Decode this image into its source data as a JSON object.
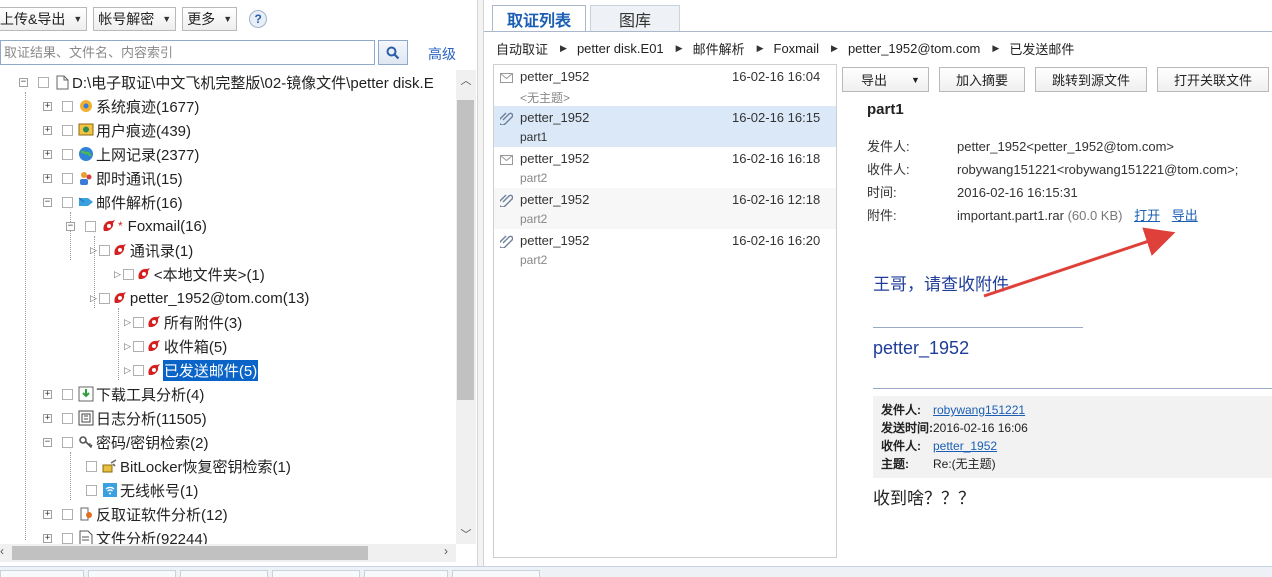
{
  "left": {
    "toolbar": {
      "upload_export": "上传&导出",
      "account_decrypt": "帐号解密",
      "more": "更多",
      "help": "?"
    },
    "search": {
      "placeholder": "取证结果、文件名、内容索引",
      "advanced": "高级"
    },
    "tree": {
      "root": "D:\\电子取证\\中文飞机完整版\\02-镜像文件\\petter disk.E",
      "system_traces": "系统痕迹(1677)",
      "user_traces": "用户痕迹(439)",
      "web_records": "上网记录(2377)",
      "im": "即时通讯(15)",
      "mail_parse": "邮件解析(16)",
      "foxmail": "Foxmail(16)",
      "contacts": "通讯录(1)",
      "local_folder": "<本地文件夹>(1)",
      "account": "petter_1952@tom.com(13)",
      "all_attachments": "所有附件(3)",
      "inbox": "收件箱(5)",
      "sent": "已发送邮件(5)",
      "download_tools": "下载工具分析(4)",
      "log_analysis": "日志分析(11505)",
      "password_search": "密码/密钥检索(2)",
      "bitlocker": "BitLocker恢复密钥检索(1)",
      "wireless": "无线帐号(1)",
      "anti_forensics": "反取证软件分析(12)",
      "file_analysis": "文件分析(92244)"
    }
  },
  "right": {
    "tabs": {
      "evidence_list": "取证列表",
      "gallery": "图库"
    },
    "breadcrumb": [
      "自动取证",
      "petter disk.E01",
      "邮件解析",
      "Foxmail",
      "petter_1952@tom.com",
      "已发送邮件"
    ],
    "mails": [
      {
        "from": "petter_1952",
        "date": "16-02-16 16:04",
        "subject": "<无主题>",
        "icon": "envelope-icon"
      },
      {
        "from": "petter_1952",
        "date": "16-02-16 16:15",
        "subject": "part1",
        "icon": "paperclip-icon"
      },
      {
        "from": "petter_1952",
        "date": "16-02-16 16:18",
        "subject": "part2",
        "icon": "envelope-icon"
      },
      {
        "from": "petter_1952",
        "date": "16-02-16 12:18",
        "subject": "part2",
        "icon": "paperclip-icon"
      },
      {
        "from": "petter_1952",
        "date": "16-02-16 16:20",
        "subject": "part2",
        "icon": "paperclip-icon"
      }
    ],
    "detail_toolbar": {
      "export": "导出",
      "add_summary": "加入摘要",
      "goto_source": "跳转到源文件",
      "open_linked": "打开关联文件"
    },
    "detail": {
      "title": "part1",
      "from_label": "发件人:",
      "from": "petter_1952<petter_1952@tom.com>",
      "to_label": "收件人:",
      "to": "robywang151221<robywang151221@tom.com>;",
      "time_label": "时间:",
      "time": "2016-02-16 16:15:31",
      "attach_label": "附件:",
      "attach_name": "important.part1.rar",
      "attach_size": "(60.0 KB)",
      "open": "打开",
      "export": "导出",
      "body": "王哥，请查收附件",
      "signature": "petter_1952",
      "quote": {
        "from_label": "发件人:",
        "from": "robywang151221",
        "sent_label": "发送时间:",
        "sent": "2016-02-16 16:06",
        "to_label": "收件人:",
        "to": "petter_1952",
        "subject_label": "主题:",
        "subject": "Re:(无主题)"
      },
      "reply": "收到啥？？？"
    }
  },
  "colors": {
    "accent": "#1a5fb4",
    "selection": "#0a64c8",
    "row_selected": "#dae8f8",
    "arrow": "#e0403a"
  }
}
